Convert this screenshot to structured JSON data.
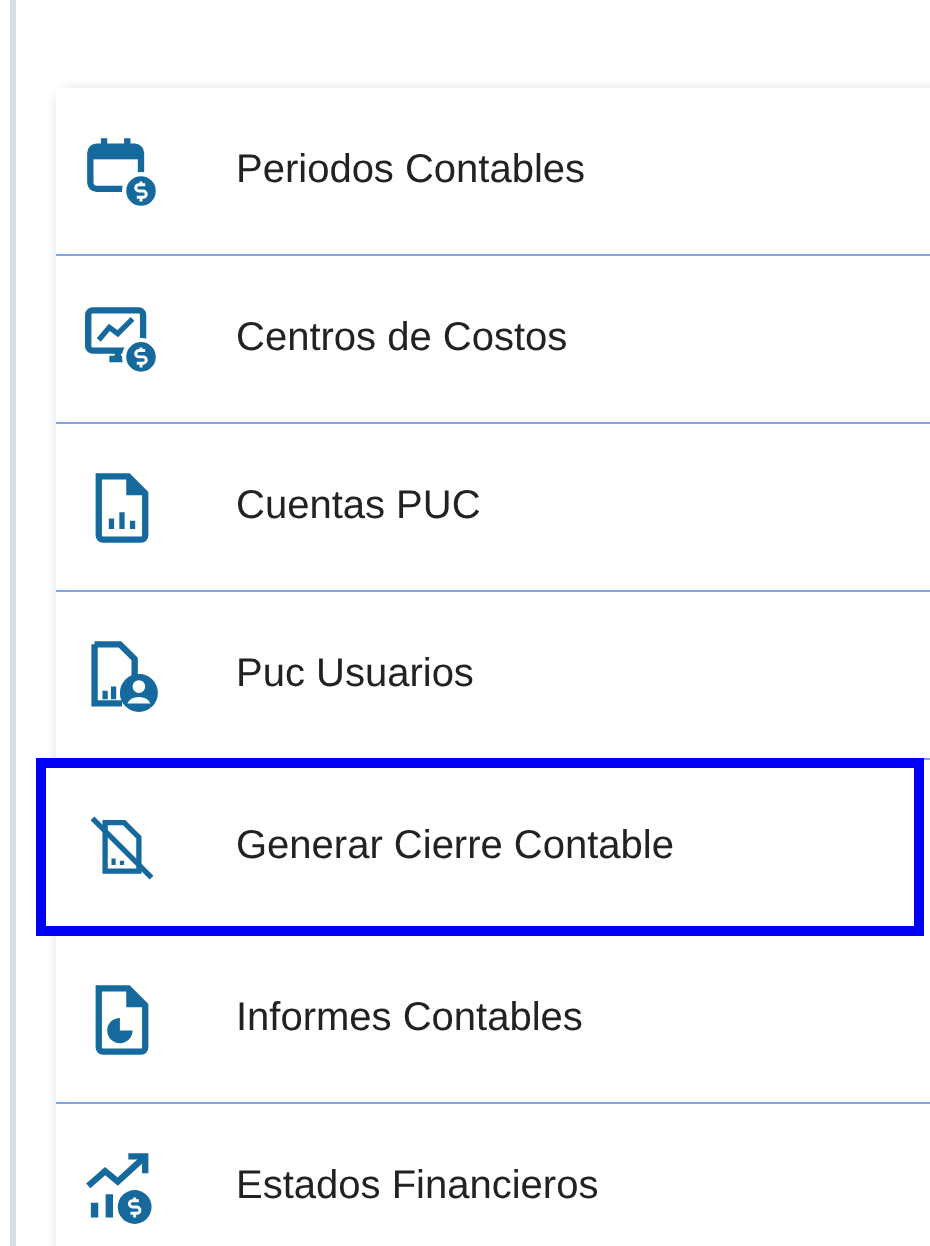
{
  "menu": {
    "items": [
      {
        "label": "Periodos Contables",
        "kind": "calendar",
        "selected": false
      },
      {
        "label": "Centros de Costos",
        "kind": "monitor",
        "selected": false
      },
      {
        "label": "Cuentas PUC",
        "kind": "doc-chart",
        "selected": false
      },
      {
        "label": "Puc Usuarios",
        "kind": "doc-user",
        "selected": false
      },
      {
        "label": "Generar Cierre Contable",
        "kind": "doc-off",
        "selected": true
      },
      {
        "label": "Informes Contables",
        "kind": "doc-pie",
        "selected": false
      },
      {
        "label": "Estados Financieros",
        "kind": "growth",
        "selected": false
      }
    ]
  }
}
